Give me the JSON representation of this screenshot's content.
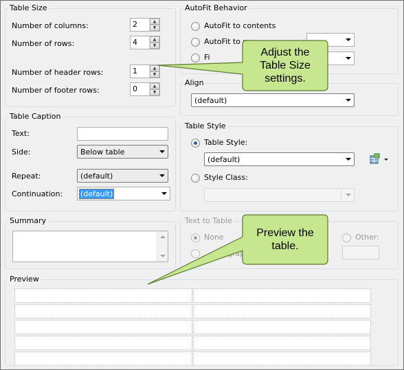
{
  "table_size": {
    "title": "Table Size",
    "columns_label": "Number of columns:",
    "columns_value": "2",
    "rows_label": "Number of rows:",
    "rows_value": "4",
    "header_rows_label": "Number of header rows:",
    "header_rows_value": "1",
    "footer_rows_label": "Number of footer rows:",
    "footer_rows_value": "0"
  },
  "autofit": {
    "title": "AutoFit Behavior",
    "option_contents": "AutoFit to contents",
    "option_window": "AutoFit to w",
    "option_fixed": "Fi"
  },
  "align": {
    "title": "Align",
    "selected": "(default)"
  },
  "caption": {
    "title": "Table Caption",
    "text_label": "Text:",
    "text_value": "",
    "side_label": "Side:",
    "side_value": "Below table",
    "repeat_label": "Repeat:",
    "repeat_value": "(default)",
    "continuation_label": "Continuation:",
    "continuation_value": "(default)"
  },
  "table_style": {
    "title": "Table Style",
    "style_option": "Table Style:",
    "style_value": "(default)",
    "class_option": "Style Class:",
    "class_value": ""
  },
  "summary": {
    "title": "Summary",
    "value": ""
  },
  "text_to_table": {
    "title": "Text to Table",
    "option_none": "None",
    "option_paragraphs": "aragraphs",
    "option_other": "Other:"
  },
  "preview": {
    "title": "Preview",
    "columns": 2,
    "rows": 4
  },
  "callouts": {
    "top": "Adjust the Table Size settings.",
    "bottom": "Preview the table."
  },
  "colors": {
    "callout_fill": "#c6e68f",
    "callout_border": "#5c7a2e",
    "selection": "#3399ff"
  }
}
